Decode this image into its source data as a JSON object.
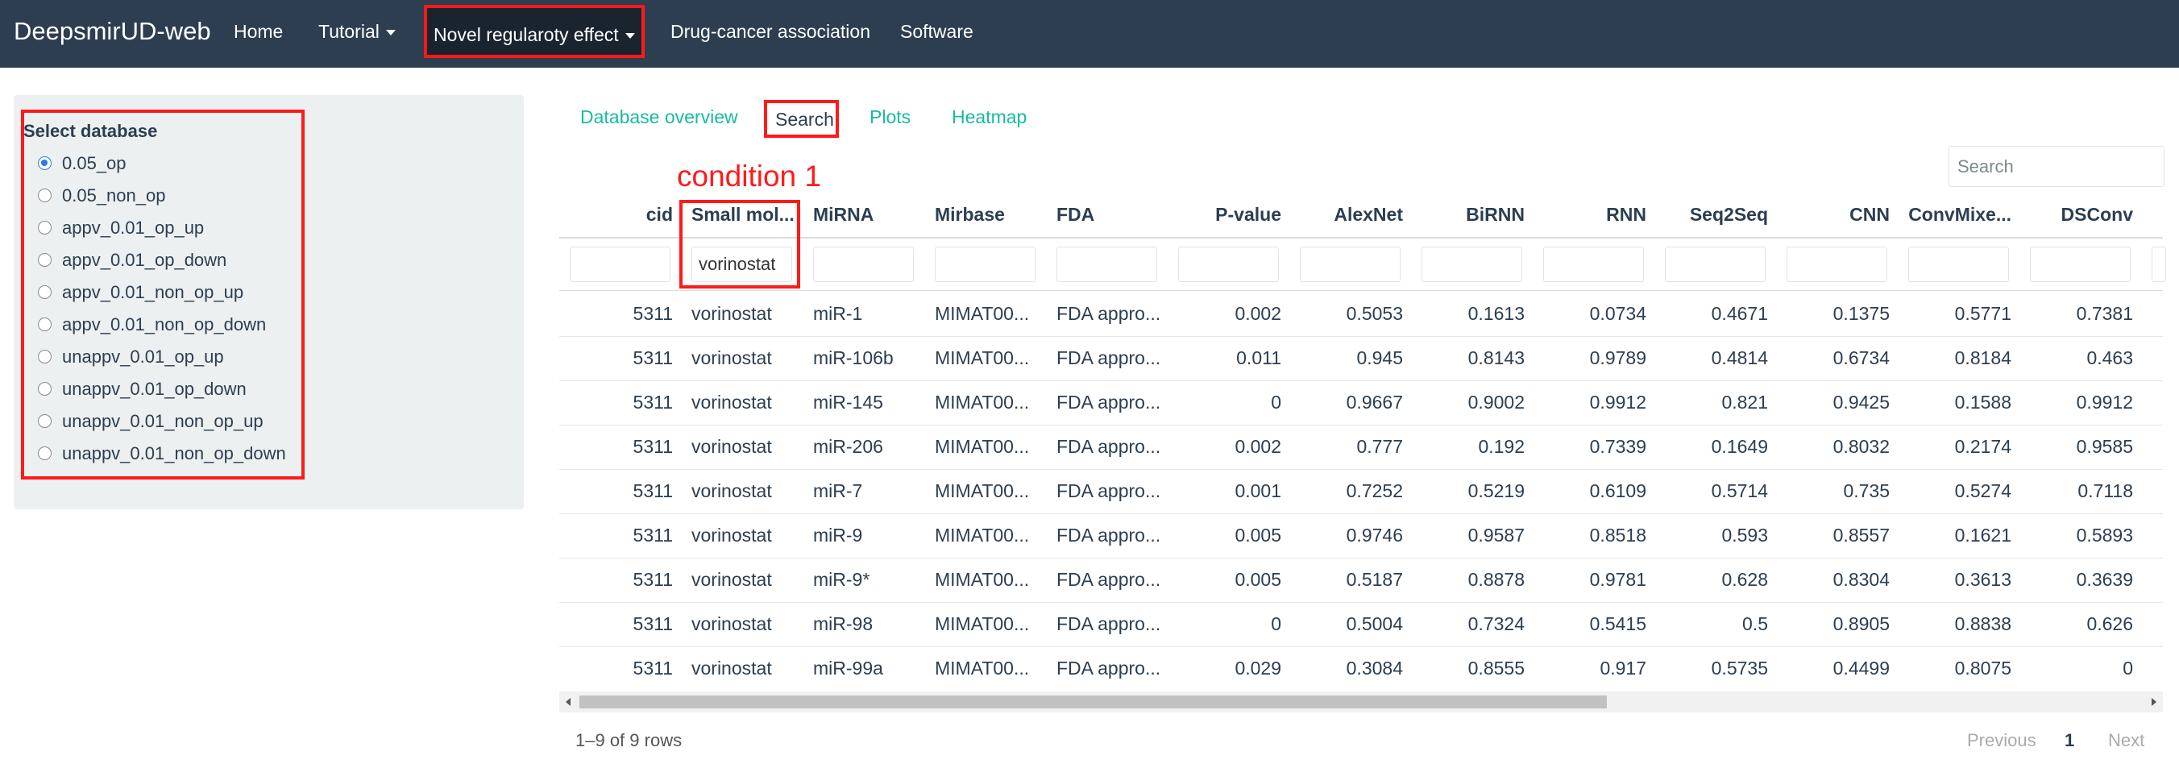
{
  "navbar": {
    "brand": "DeepsmirUD-web",
    "items": [
      "Home",
      "Tutorial",
      "Novel regularoty effect",
      "Drug-cancer association",
      "Software"
    ]
  },
  "sidebar": {
    "title": "Select database",
    "options": [
      "0.05_op",
      "0.05_non_op",
      "appv_0.01_op_up",
      "appv_0.01_op_down",
      "appv_0.01_non_op_up",
      "appv_0.01_non_op_down",
      "unappv_0.01_op_up",
      "unappv_0.01_op_down",
      "unappv_0.01_non_op_up",
      "unappv_0.01_non_op_down"
    ],
    "selected": "0.05_op"
  },
  "tabs": [
    "Database overview",
    "Search",
    "Plots",
    "Heatmap"
  ],
  "search": {
    "placeholder": "Search"
  },
  "annotation": "condition 1",
  "table": {
    "columns": [
      "cid",
      "Small mol...",
      "MiRNA",
      "Mirbase",
      "FDA",
      "P-value",
      "AlexNet",
      "BiRNN",
      "RNN",
      "Seq2Seq",
      "CNN",
      "ConvMixe...",
      "DSConv"
    ],
    "filter_small_mol": "vorinostat",
    "rows": [
      [
        "5311",
        "vorinostat",
        "miR-1",
        "MIMAT00...",
        "FDA appro...",
        "0.002",
        "0.5053",
        "0.1613",
        "0.0734",
        "0.4671",
        "0.1375",
        "0.5771",
        "0.7381"
      ],
      [
        "5311",
        "vorinostat",
        "miR-106b",
        "MIMAT00...",
        "FDA appro...",
        "0.011",
        "0.945",
        "0.8143",
        "0.9789",
        "0.4814",
        "0.6734",
        "0.8184",
        "0.463"
      ],
      [
        "5311",
        "vorinostat",
        "miR-145",
        "MIMAT00...",
        "FDA appro...",
        "0",
        "0.9667",
        "0.9002",
        "0.9912",
        "0.821",
        "0.9425",
        "0.1588",
        "0.9912"
      ],
      [
        "5311",
        "vorinostat",
        "miR-206",
        "MIMAT00...",
        "FDA appro...",
        "0.002",
        "0.777",
        "0.192",
        "0.7339",
        "0.1649",
        "0.8032",
        "0.2174",
        "0.9585"
      ],
      [
        "5311",
        "vorinostat",
        "miR-7",
        "MIMAT00...",
        "FDA appro...",
        "0.001",
        "0.7252",
        "0.5219",
        "0.6109",
        "0.5714",
        "0.735",
        "0.5274",
        "0.7118"
      ],
      [
        "5311",
        "vorinostat",
        "miR-9",
        "MIMAT00...",
        "FDA appro...",
        "0.005",
        "0.9746",
        "0.9587",
        "0.8518",
        "0.593",
        "0.8557",
        "0.1621",
        "0.5893"
      ],
      [
        "5311",
        "vorinostat",
        "miR-9*",
        "MIMAT00...",
        "FDA appro...",
        "0.005",
        "0.5187",
        "0.8878",
        "0.9781",
        "0.628",
        "0.8304",
        "0.3613",
        "0.3639"
      ],
      [
        "5311",
        "vorinostat",
        "miR-98",
        "MIMAT00...",
        "FDA appro...",
        "0",
        "0.5004",
        "0.7324",
        "0.5415",
        "0.5",
        "0.8905",
        "0.8838",
        "0.626"
      ],
      [
        "5311",
        "vorinostat",
        "miR-99a",
        "MIMAT00...",
        "FDA appro...",
        "0.029",
        "0.3084",
        "0.8555",
        "0.917",
        "0.5735",
        "0.4499",
        "0.8075",
        "0"
      ]
    ]
  },
  "pagination": {
    "summary": "1–9 of 9 rows",
    "previous": "Previous",
    "page": "1",
    "next": "Next"
  },
  "colors": {
    "navbar": "#2c3e50",
    "accent": "#18bc9c",
    "highlight": "#ff1a1a"
  }
}
